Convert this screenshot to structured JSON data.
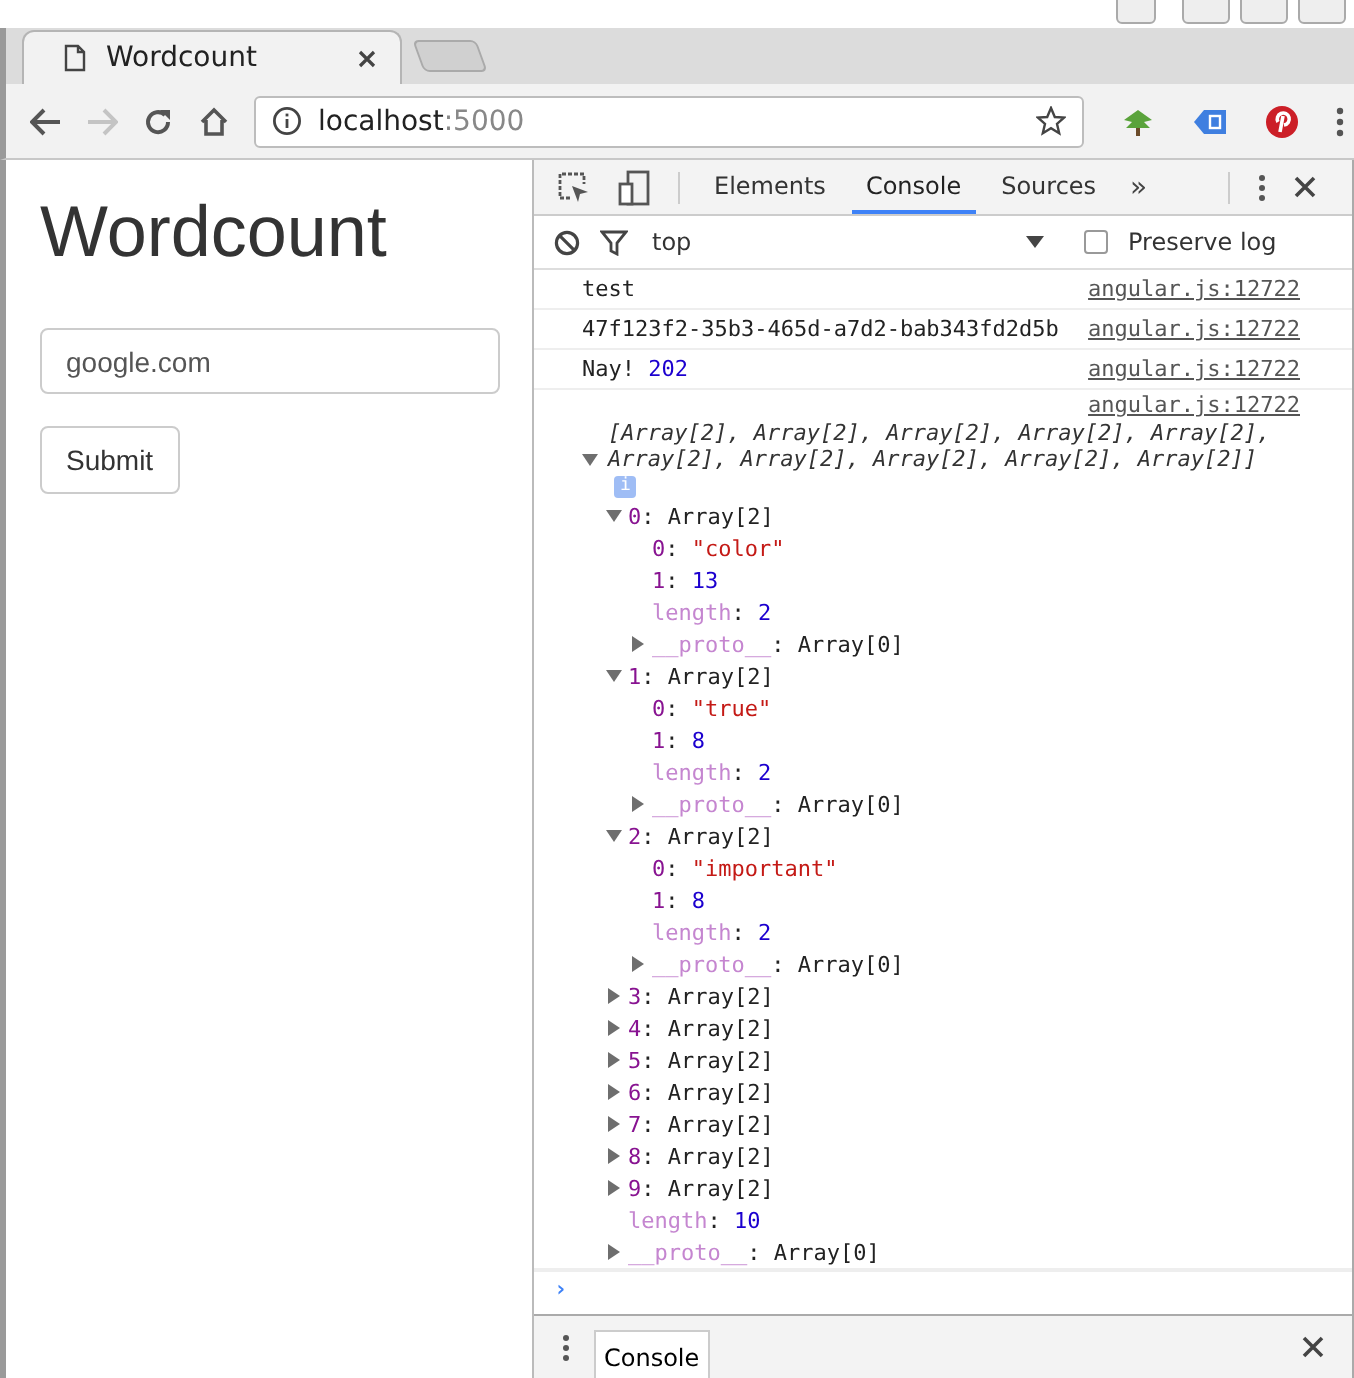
{
  "browser": {
    "tab_title": "Wordcount",
    "address_host": "localhost",
    "address_port": ":5000"
  },
  "page": {
    "heading": "Wordcount",
    "input_value": "google.com",
    "submit_label": "Submit"
  },
  "devtools": {
    "tabs": [
      {
        "label": "Elements",
        "selected": false
      },
      {
        "label": "Console",
        "selected": true
      },
      {
        "label": "Sources",
        "selected": false
      }
    ],
    "more": "»",
    "context": "top",
    "preserve_log": {
      "label": "Preserve log",
      "checked": false
    },
    "messages": [
      {
        "parts": [
          {
            "text": "test",
            "kind": "plain"
          }
        ],
        "source": "angular.js:12722"
      },
      {
        "parts": [
          {
            "text": "47f123f2-35b3-465d-a7d2-bab343fd2d5b",
            "kind": "plain"
          }
        ],
        "source": "angular.js:12722"
      },
      {
        "parts": [
          {
            "text": "Nay!",
            "kind": "plain"
          },
          {
            "text": "202",
            "kind": "number"
          }
        ],
        "source": "angular.js:12722"
      }
    ],
    "log_source": "angular.js:12722",
    "tree": {
      "separator": ":",
      "summary": "[Array[2], Array[2], Array[2], Array[2], Array[2], Array[2], Array[2], Array[2], Array[2], Array[2]]",
      "expanded": true,
      "info": "i",
      "children": [
        {
          "key": "0",
          "value": "Array[2]",
          "kind": "object",
          "expanded": true,
          "children": [
            {
              "key": "0",
              "value": "\"color\"",
              "kind": "string"
            },
            {
              "key": "1",
              "value": "13",
              "kind": "number"
            },
            {
              "key": "length",
              "value": "2",
              "kind": "number",
              "internal": true
            },
            {
              "key": "__proto__",
              "value": "Array[0]",
              "kind": "object",
              "internal": true,
              "expanded": false
            }
          ]
        },
        {
          "key": "1",
          "value": "Array[2]",
          "kind": "object",
          "expanded": true,
          "children": [
            {
              "key": "0",
              "value": "\"true\"",
              "kind": "string"
            },
            {
              "key": "1",
              "value": "8",
              "kind": "number"
            },
            {
              "key": "length",
              "value": "2",
              "kind": "number",
              "internal": true
            },
            {
              "key": "__proto__",
              "value": "Array[0]",
              "kind": "object",
              "internal": true,
              "expanded": false
            }
          ]
        },
        {
          "key": "2",
          "value": "Array[2]",
          "kind": "object",
          "expanded": true,
          "children": [
            {
              "key": "0",
              "value": "\"important\"",
              "kind": "string"
            },
            {
              "key": "1",
              "value": "8",
              "kind": "number"
            },
            {
              "key": "length",
              "value": "2",
              "kind": "number",
              "internal": true
            },
            {
              "key": "__proto__",
              "value": "Array[0]",
              "kind": "object",
              "internal": true,
              "expanded": false
            }
          ]
        },
        {
          "key": "3",
          "value": "Array[2]",
          "kind": "object",
          "expanded": false
        },
        {
          "key": "4",
          "value": "Array[2]",
          "kind": "object",
          "expanded": false
        },
        {
          "key": "5",
          "value": "Array[2]",
          "kind": "object",
          "expanded": false
        },
        {
          "key": "6",
          "value": "Array[2]",
          "kind": "object",
          "expanded": false
        },
        {
          "key": "7",
          "value": "Array[2]",
          "kind": "object",
          "expanded": false
        },
        {
          "key": "8",
          "value": "Array[2]",
          "kind": "object",
          "expanded": false
        },
        {
          "key": "9",
          "value": "Array[2]",
          "kind": "object",
          "expanded": false
        },
        {
          "key": "length",
          "value": "10",
          "kind": "number",
          "internal": true
        },
        {
          "key": "__proto__",
          "value": "Array[0]",
          "kind": "object",
          "internal": true,
          "expanded": false
        }
      ]
    },
    "prompt": "›",
    "drawer_tab": "Console"
  }
}
